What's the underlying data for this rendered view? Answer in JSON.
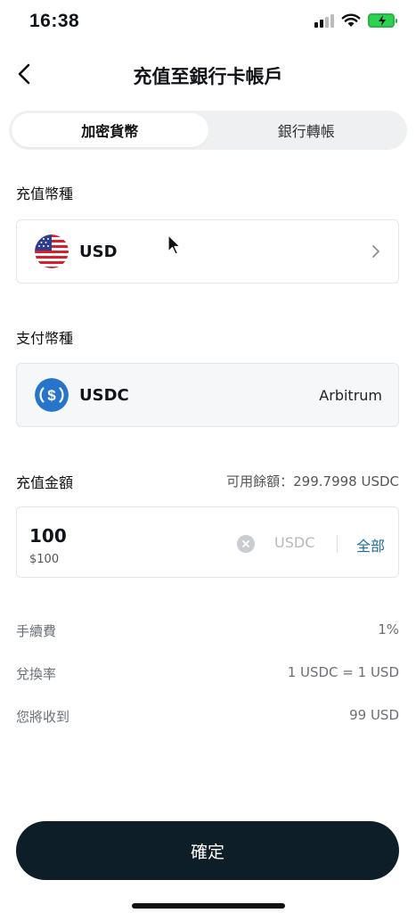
{
  "status_bar": {
    "time": "16:38"
  },
  "header": {
    "title": "充值至銀行卡帳戶"
  },
  "tabs": [
    {
      "label": "加密貨幣",
      "active": true
    },
    {
      "label": "銀行轉帳",
      "active": false
    }
  ],
  "deposit_currency": {
    "label": "充值幣種",
    "code": "USD",
    "icon": "us-flag-icon"
  },
  "pay_currency": {
    "label": "支付幣種",
    "code": "USDC",
    "network": "Arbitrum",
    "icon": "usdc-icon"
  },
  "amount": {
    "label": "充值金額",
    "available": "可用餘額：299.7998 USDC",
    "value": "100",
    "fiat": "$100",
    "unit": "USDC",
    "all_label": "全部"
  },
  "summary": [
    {
      "label": "手續費",
      "value": "1%"
    },
    {
      "label": "兌換率",
      "value": "1 USDC = 1 USD"
    },
    {
      "label": "您將收到",
      "value": "99 USD"
    }
  ],
  "confirm_label": "確定",
  "colors": {
    "accent": "#1f6f9c",
    "button": "#0e1e28",
    "usdc": "#2775ca"
  }
}
